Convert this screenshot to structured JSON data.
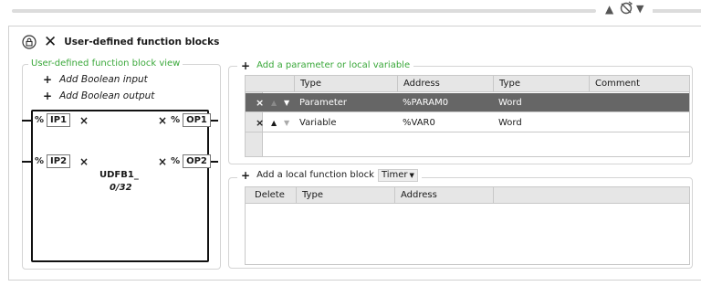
{
  "toolbar": {
    "icons": {
      "up": "triangle-up-icon",
      "sync": "sync-icon",
      "down": "triangle-down-icon"
    }
  },
  "header": {
    "title": "User-defined function blocks",
    "close_icon": "close-icon",
    "lock_icon": "lock-icon"
  },
  "view": {
    "legend": "User-defined function block view",
    "add_input": "Add Boolean input",
    "add_output": "Add Boolean output",
    "pct": "%",
    "remove_symbol": "×",
    "inputs": [
      "IP1",
      "IP2"
    ],
    "outputs": [
      "OP1",
      "OP2"
    ],
    "block_name": "UDFB1_",
    "block_count": "0/32"
  },
  "params": {
    "title": "Add a parameter or local variable",
    "plus": "+",
    "columns": [
      "Type",
      "Address",
      "Type",
      "Comment"
    ],
    "rows": [
      {
        "kind": "Parameter",
        "address": "%PARAM0",
        "data_type": "Word",
        "comment": "",
        "selected": true
      },
      {
        "kind": "Variable",
        "address": "%VAR0",
        "data_type": "Word",
        "comment": "",
        "selected": false
      }
    ],
    "row_controls": {
      "delete": "×",
      "up": "▲",
      "down": "▼"
    }
  },
  "local_fb": {
    "title": "Add a local function block",
    "plus": "+",
    "selected_type": "Timer",
    "columns": [
      "Delete",
      "Type",
      "Address"
    ]
  },
  "colors": {
    "green_text": "#3aa83a",
    "selected_row": "#666666",
    "grid_header": "#e6e6e6"
  }
}
